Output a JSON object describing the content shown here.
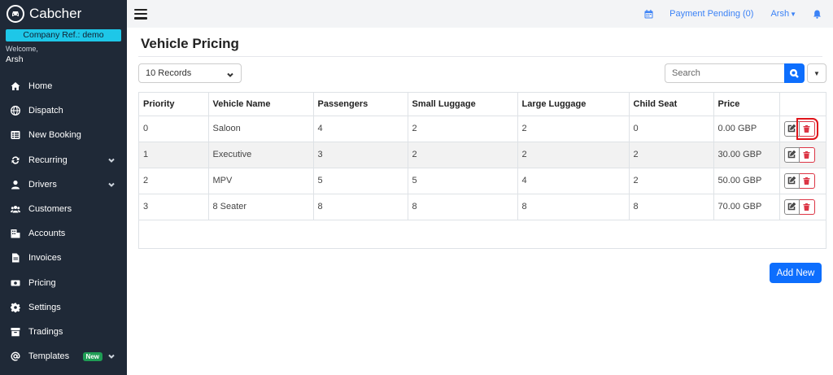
{
  "brand": {
    "name": "Cabcher",
    "company_ref": "Company Ref.: demo",
    "welcome": "Welcome,",
    "user": "Arsh"
  },
  "nav": [
    {
      "label": "Home",
      "icon": "home-icon"
    },
    {
      "label": "Dispatch",
      "icon": "globe-icon"
    },
    {
      "label": "New Booking",
      "icon": "list-icon"
    },
    {
      "label": "Recurring",
      "icon": "repeat-icon",
      "has_chevron": true
    },
    {
      "label": "Drivers",
      "icon": "user-icon",
      "has_chevron": true
    },
    {
      "label": "Customers",
      "icon": "users-icon"
    },
    {
      "label": "Accounts",
      "icon": "building-icon"
    },
    {
      "label": "Invoices",
      "icon": "file-icon"
    },
    {
      "label": "Pricing",
      "icon": "money-icon"
    },
    {
      "label": "Settings",
      "icon": "gear-icon"
    },
    {
      "label": "Tradings",
      "icon": "box-icon"
    },
    {
      "label": "Templates",
      "icon": "at-icon",
      "badge": "New",
      "has_chevron": true
    }
  ],
  "topbar": {
    "payment_pending": "Payment Pending (0)",
    "user_menu": "Arsh"
  },
  "page": {
    "title": "Vehicle Pricing"
  },
  "controls": {
    "records": "10 Records",
    "search_placeholder": "Search"
  },
  "table": {
    "columns": [
      "Priority",
      "Vehicle Name",
      "Passengers",
      "Small Luggage",
      "Large Luggage",
      "Child Seat",
      "Price",
      ""
    ],
    "rows": [
      [
        "0",
        "Saloon",
        "4",
        "2",
        "2",
        "0",
        "0.00 GBP"
      ],
      [
        "1",
        "Executive",
        "3",
        "2",
        "2",
        "2",
        "30.00 GBP"
      ],
      [
        "2",
        "MPV",
        "5",
        "5",
        "4",
        "2",
        "50.00 GBP"
      ],
      [
        "3",
        "8 Seater",
        "8",
        "8",
        "8",
        "8",
        "70.00 GBP"
      ]
    ]
  },
  "add_new_label": "Add New",
  "colors": {
    "sidebar": "#1f2937",
    "accent": "#0d6efd",
    "company_ref": "#1ec7e8",
    "danger": "#dc3545",
    "highlight": "#e0141b"
  }
}
